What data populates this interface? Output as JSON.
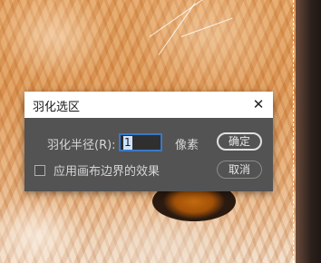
{
  "dialog": {
    "title": "羽化选区",
    "close_glyph": "✕",
    "radius_label": "羽化半径(R):",
    "radius_value": "1",
    "unit_label": "像素",
    "checkbox_label": "应用画布边界的效果",
    "checkbox_checked": false,
    "ok_label": "确定",
    "cancel_label": "取消"
  },
  "colors": {
    "dialog_bg": "#535353",
    "titlebar_bg": "#ffffff",
    "input_focus": "#3a78c9"
  },
  "icons": {
    "close": "close-icon",
    "checkbox": "checkbox-icon"
  }
}
